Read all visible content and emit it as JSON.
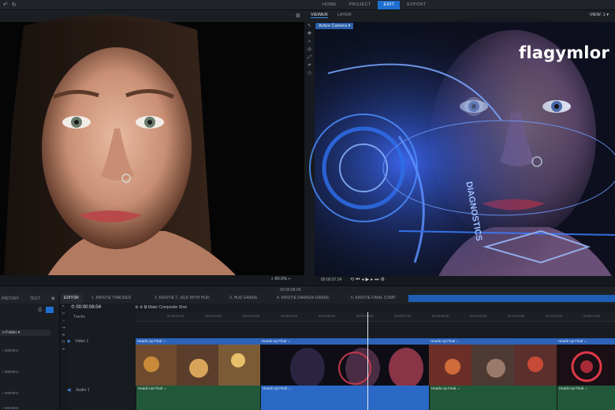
{
  "topbar": {
    "menu": [
      "HOME",
      "PROJECT",
      "EDIT",
      "EXPORT"
    ],
    "active_menu": "EDIT"
  },
  "left_viewer": {
    "zoom": "80.0%"
  },
  "right_viewer": {
    "tabs": [
      "VIEWER",
      "LAYER"
    ],
    "active_tab": "VIEWER",
    "view_select": "VIEW: 1",
    "camera": "Active Camera",
    "timecode": "00:00:07:24",
    "hud_text": "DIAGNOSTICS"
  },
  "watermark": "flagymlor",
  "midbar": {
    "timecode": "00:00:08:09"
  },
  "left_panel": {
    "tabs": [
      "HISTORY",
      "TEXT"
    ],
    "folder": "n Folder",
    "items": [
      "r 48000Hz",
      "r 48000Hz",
      "r 48000Hz",
      "r 48000Hz"
    ]
  },
  "editor": {
    "tabs": [
      "EDITOR",
      "1. KIRSTIE TRACKED",
      "2. KIRSTIE T...KED WITH HUD",
      "3. HUD GRADE",
      "4. KIRSTIE DARKEN GRADE",
      "5. KIRSTIE FINAL COMP"
    ],
    "active_tab": "EDITOR",
    "timecode": "00:00:06:04",
    "make_composite": "Make Composite Shot",
    "tracks_label": "Tracks",
    "video_track": "Video 1",
    "audio_track": "Audio 1",
    "ruler_ticks": [
      "00:00:01:00",
      "00:00:02:00",
      "00:00:03:00",
      "00:00:04:00",
      "00:00:05:00",
      "00:00:06:00",
      "00:00:07:00",
      "00:00:08:00",
      "00:00:09:00",
      "00:00:10:00",
      "00:00:11:00",
      "00:00:12:00"
    ],
    "video_clips": [
      {
        "label": "Heads Up Final"
      },
      {
        "label": "Heads Up Final"
      },
      {
        "label": "Heads Up Final"
      },
      {
        "label": "Heads Up Final"
      }
    ],
    "audio_clips": [
      {
        "label": "Heads Up Final"
      },
      {
        "label": "Heads Up Final"
      },
      {
        "label": "Heads Up Final"
      },
      {
        "label": "Heads Up Final"
      }
    ]
  },
  "colors": {
    "accent": "#1f6fd1",
    "clip_header": "#2d63b9",
    "audio_clip": "#22583a"
  }
}
